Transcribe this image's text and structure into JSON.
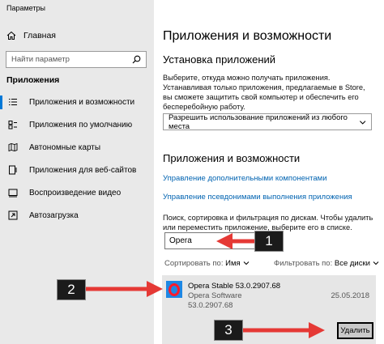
{
  "window": {
    "title": "Параметры"
  },
  "sidebar": {
    "home_label": "Главная",
    "search_placeholder": "Найти параметр",
    "section_heading": "Приложения",
    "items": [
      {
        "label": "Приложения и возможности",
        "icon": "list-icon",
        "active": true
      },
      {
        "label": "Приложения по умолчанию",
        "icon": "default-apps-icon"
      },
      {
        "label": "Автономные карты",
        "icon": "map-icon"
      },
      {
        "label": "Приложения для веб-сайтов",
        "icon": "web-app-icon"
      },
      {
        "label": "Воспроизведение видео",
        "icon": "video-icon"
      },
      {
        "label": "Автозагрузка",
        "icon": "startup-icon"
      }
    ]
  },
  "main": {
    "title": "Приложения и возможности",
    "install_heading": "Установка приложений",
    "install_description": "Выберите, откуда можно получать приложения. Устанавливая только приложения, предлагаемые в Store, вы сможете защитить свой компьютер и обеспечить его бесперебойную работу.",
    "install_dropdown_value": "Разрешить использование приложений из любого места",
    "apps_heading": "Приложения и возможности",
    "link_optional_features": "Управление дополнительными компонентами",
    "link_app_aliases": "Управление псевдонимами выполнения приложения",
    "search_description": "Поиск, сортировка и фильтрация по дискам. Чтобы удалить или переместить приложение, выберите его в списке.",
    "search_value": "Opera",
    "sort_label": "Сортировать по:",
    "sort_value": "Имя",
    "filter_label": "Фильтровать по:",
    "filter_value": "Все диски",
    "app": {
      "name": "Opera Stable 53.0.2907.68",
      "publisher": "Opera Software",
      "version": "53.0.2907.68",
      "date": "25.05.2018",
      "uninstall_label": "Удалить"
    }
  },
  "callouts": [
    {
      "number": "1"
    },
    {
      "number": "2"
    },
    {
      "number": "3"
    }
  ],
  "colors": {
    "accent": "#0078d7",
    "link": "#0063b1",
    "arrow": "#e53935",
    "sidebar_bg": "#e9e9e9"
  }
}
